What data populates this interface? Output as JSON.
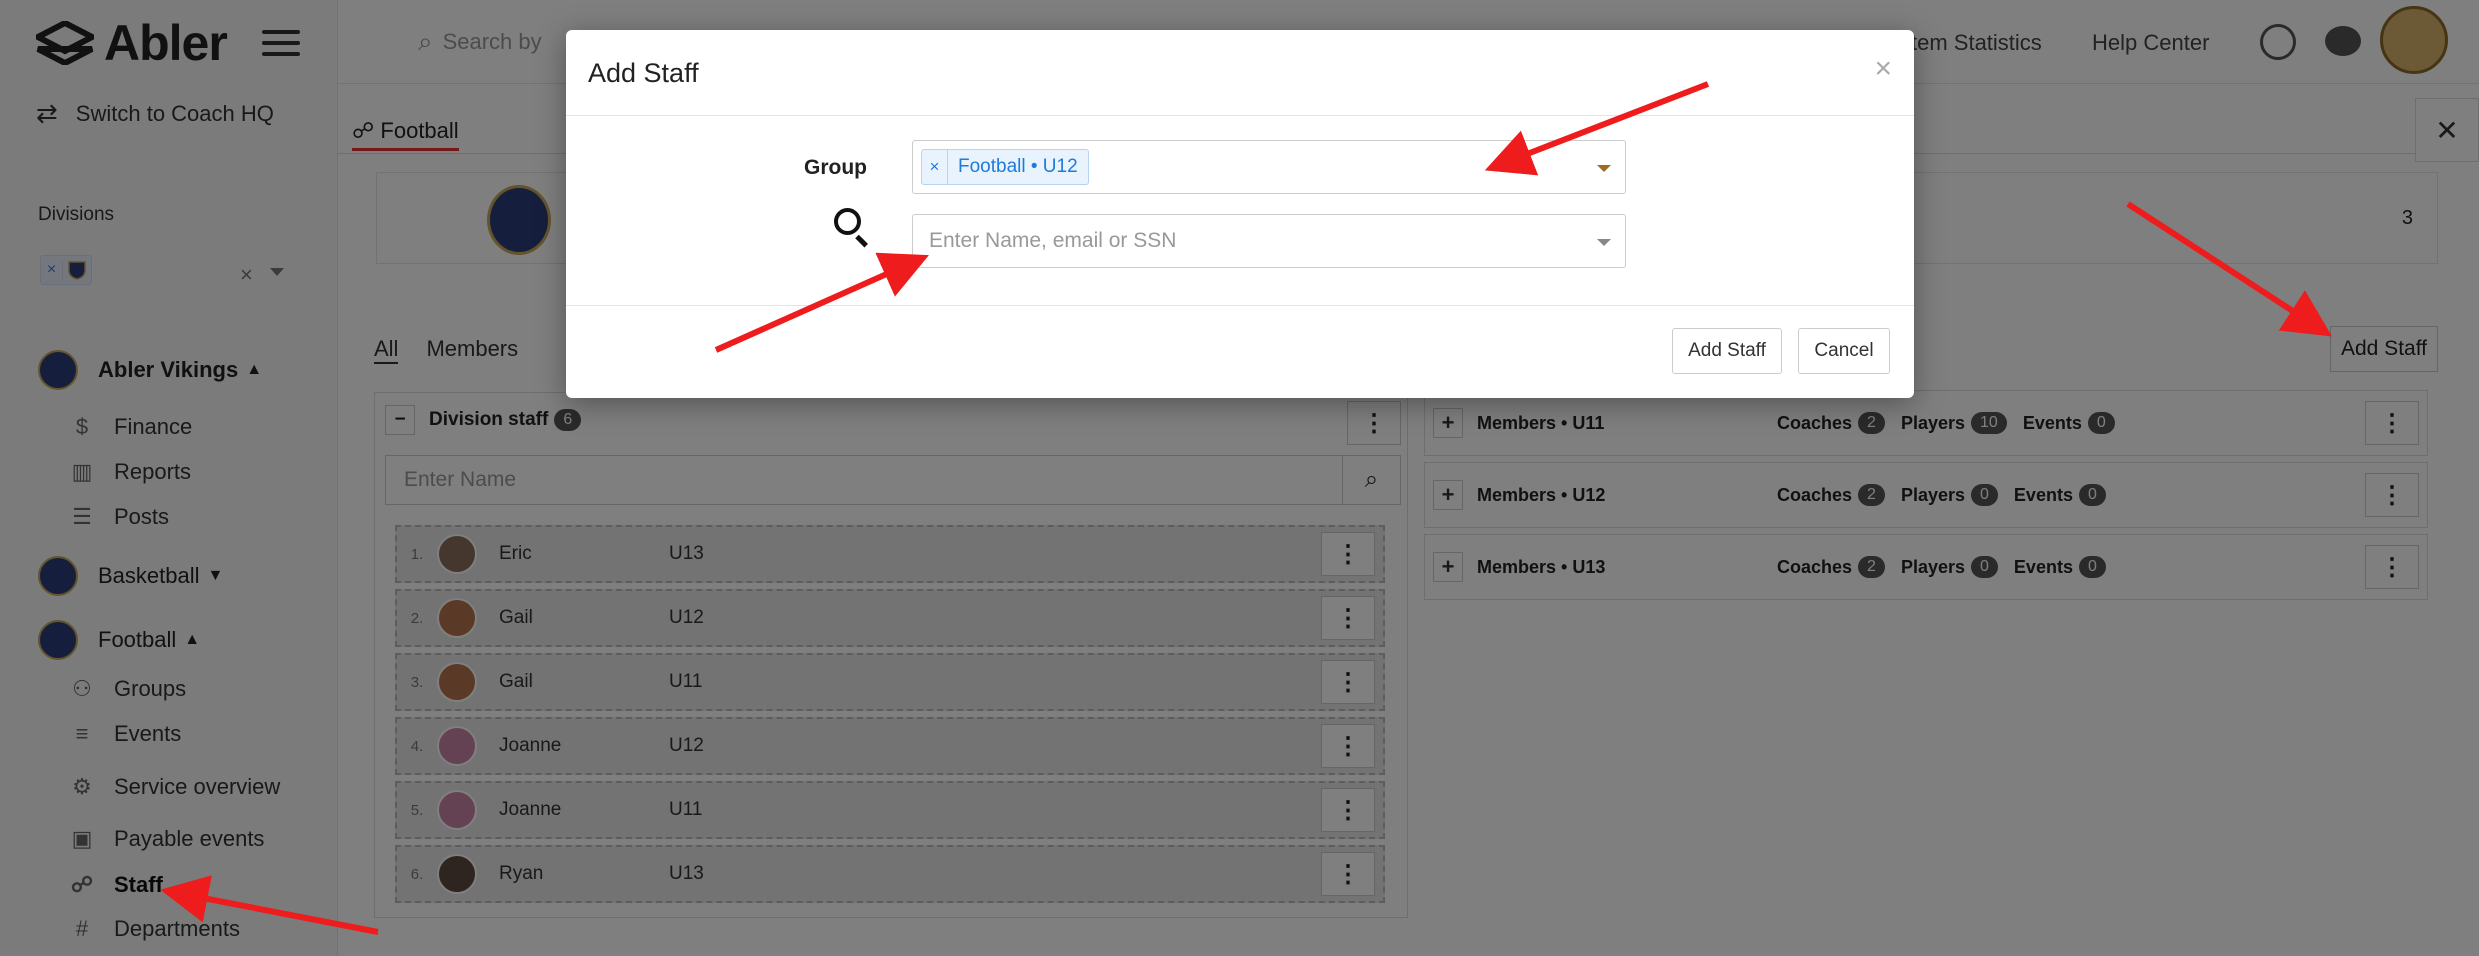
{
  "app": {
    "name": "Abler",
    "switch_label": "Switch to Coach HQ"
  },
  "sidebar": {
    "divisions_label": "Divisions",
    "clubs": [
      {
        "label": "Abler Vikings",
        "expanded": true
      },
      {
        "label": "Basketball",
        "expanded": false
      },
      {
        "label": "Football",
        "expanded": true
      }
    ],
    "club_items": [
      {
        "label": "Finance",
        "icon": "dollar-icon"
      },
      {
        "label": "Reports",
        "icon": "bar-chart-icon"
      },
      {
        "label": "Posts",
        "icon": "posts-icon"
      }
    ],
    "football_items": [
      {
        "label": "Groups",
        "icon": "people-icon"
      },
      {
        "label": "Events",
        "icon": "list-icon"
      },
      {
        "label": "Service overview",
        "icon": "gear-icon"
      },
      {
        "label": "Payable events",
        "icon": "calendar-icon"
      },
      {
        "label": "Staff",
        "icon": "whistle-icon",
        "active": true
      },
      {
        "label": "Departments",
        "icon": "hash-icon"
      }
    ]
  },
  "topbar": {
    "search_placeholder": "Search by",
    "links": [
      "stem Statistics",
      "Help Center"
    ]
  },
  "main": {
    "tab_label": "Football",
    "info_count": "3",
    "subtabs": [
      "All",
      "Members"
    ],
    "add_staff_label": "Add Staff",
    "staff_panel": {
      "title": "Division staff",
      "count": "6",
      "search_placeholder": "Enter Name",
      "rows": [
        {
          "num": "1.",
          "name": "Eric",
          "group": "U13"
        },
        {
          "num": "2.",
          "name": "Gail",
          "group": "U12"
        },
        {
          "num": "3.",
          "name": "Gail",
          "group": "U11"
        },
        {
          "num": "4.",
          "name": "Joanne",
          "group": "U12"
        },
        {
          "num": "5.",
          "name": "Joanne",
          "group": "U11"
        },
        {
          "num": "6.",
          "name": "Ryan",
          "group": "U13"
        }
      ]
    },
    "groups": [
      {
        "name": "Members • U11",
        "coaches": "2",
        "players": "10",
        "events": "0"
      },
      {
        "name": "Members • U12",
        "coaches": "2",
        "players": "0",
        "events": "0"
      },
      {
        "name": "Members • U13",
        "coaches": "2",
        "players": "0",
        "events": "0"
      }
    ],
    "group_stat_labels": {
      "coaches": "Coaches",
      "players": "Players",
      "events": "Events"
    }
  },
  "modal": {
    "title": "Add Staff",
    "close_glyph": "×",
    "group_label": "Group",
    "group_chip": "Football • U12",
    "chip_remove": "×",
    "name_placeholder": "Enter Name, email or SSN",
    "add_button": "Add Staff",
    "cancel_button": "Cancel"
  },
  "colors": {
    "arrow": "#ee1c1c",
    "chip_text": "#1e7bd8",
    "overlay": "rgba(0,0,0,0.5)"
  }
}
